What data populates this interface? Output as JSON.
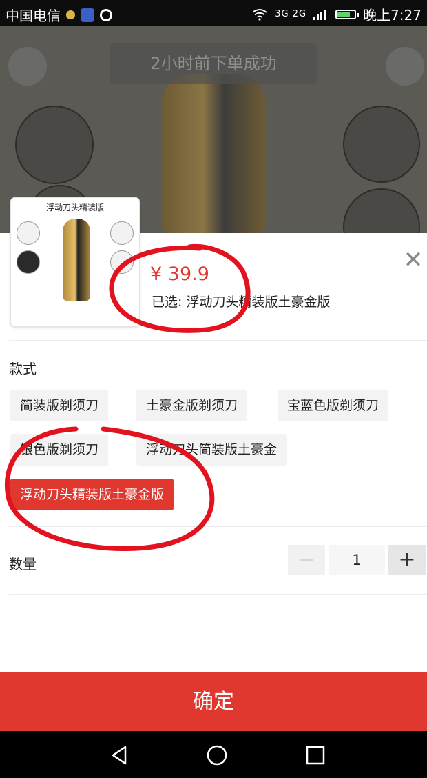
{
  "status_bar": {
    "carrier": "中国电信",
    "signal_label": "3G 2G",
    "time": "晚上7:27"
  },
  "background": {
    "toast_text": "2小时前下单成功"
  },
  "sku_sheet": {
    "thumbnail_title": "浮动刀头精装版",
    "price": "¥ 39.9",
    "selected_text": "已选: 浮动刀头精装版土豪金版",
    "style_label": "款式",
    "options": [
      {
        "label": "简装版剃须刀",
        "selected": false
      },
      {
        "label": "土豪金版剃须刀",
        "selected": false
      },
      {
        "label": "宝蓝色版剃须刀",
        "selected": false
      },
      {
        "label": "银色版剃须刀",
        "selected": false
      },
      {
        "label": "浮动刀头简装版土豪金",
        "selected": false
      },
      {
        "label": "浮动刀头精装版土豪金版",
        "selected": true
      }
    ],
    "quantity_label": "数量",
    "quantity": "1",
    "decrement": "−",
    "increment": "+",
    "confirm_label": "确定"
  },
  "colors": {
    "accent": "#e0382f",
    "annotation": "#e3121f"
  },
  "icons": [
    "wifi-icon",
    "battery-icon",
    "close-icon",
    "back-nav-icon",
    "home-nav-icon",
    "recents-nav-icon"
  ]
}
